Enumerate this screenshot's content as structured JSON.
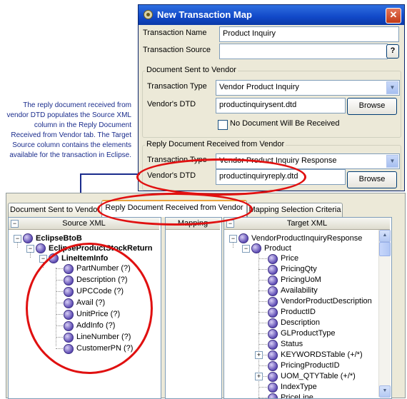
{
  "dialog": {
    "title": "New Transaction Map",
    "close_glyph": "✕",
    "transaction_name_label": "Transaction Name",
    "transaction_name_value": "Product Inquiry",
    "transaction_source_label": "Transaction Source",
    "transaction_source_value": "",
    "help_glyph": "?",
    "sent_group": {
      "title": "Document Sent to Vendor",
      "transaction_type_label": "Transaction Type",
      "transaction_type_value": "Vendor Product Inquiry",
      "dtd_label": "Vendor's DTD",
      "dtd_value": "productinquirysent.dtd",
      "browse_label": "Browse",
      "no_doc_label": "No Document Will Be Received"
    },
    "reply_group": {
      "title": "Reply Document Received from Vendor",
      "transaction_type_label": "Transaction Type",
      "transaction_type_value": "Vendor Product Inquiry Response",
      "dtd_label": "Vendor's DTD",
      "dtd_value": "productinquiryreply.dtd",
      "browse_label": "Browse"
    }
  },
  "annotation": "The reply document received from vendor DTD populates the Source XML column in the Reply Document Received from Vendor tab. The Target Source column contains the elements available for the transaction in Eclipse.",
  "tabs": [
    "Document Sent to Vendor",
    "Reply Document Received from Vendor",
    "Mapping Selection Criteria"
  ],
  "active_tab": 1,
  "source": {
    "header": "Source XML",
    "root": "EclipseBtoB",
    "child": "EclipseProductStockReturn",
    "grandchild": "LineItemInfo",
    "leaves": [
      "PartNumber (?)",
      "Description (?)",
      "UPCCode (?)",
      "Avail (?)",
      "UnitPrice (?)",
      "AddInfo (?)",
      "LineNumber (?)",
      "CustomerPN (?)"
    ]
  },
  "mapping": {
    "header": "Mapping"
  },
  "target": {
    "header": "Target XML",
    "root": "VendorProductInquiryResponse",
    "child": "Product",
    "items": [
      "Price",
      "PricingQty",
      "PricingUoM",
      "Availability",
      "VendorProductDescription",
      "ProductID",
      "Description",
      "GLProductType",
      "Status",
      "KEYWORDSTable (+/*)",
      "PricingProductID",
      "UOM_QTYTable (+/*)",
      "IndexType",
      "PriceLine"
    ],
    "expandable": [
      9,
      11
    ]
  },
  "colors": {
    "accent": "#e01010",
    "annotation": "#1a2c8c",
    "title_bar": "#1148c8"
  },
  "icons": [
    "app-icon",
    "close-icon",
    "help-icon",
    "dropdown-arrow-icon",
    "xml-element-icon",
    "expand-icon",
    "collapse-icon",
    "scroll-up-icon",
    "scroll-down-icon"
  ]
}
